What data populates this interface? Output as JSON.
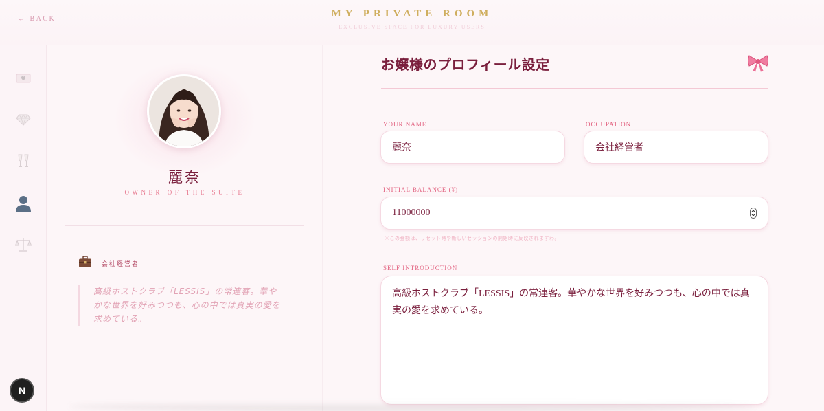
{
  "header": {
    "back_label": "← BACK",
    "brand_title": "MY PRIVATE ROOM",
    "brand_subtitle": "EXCLUSIVE SPACE FOR LUXURY USERS"
  },
  "sidebar": {
    "items": [
      {
        "icon": "heart-envelope-icon"
      },
      {
        "icon": "diamond-icon"
      },
      {
        "icon": "champagne-glasses-icon"
      },
      {
        "icon": "user-icon",
        "active": true
      },
      {
        "icon": "scales-icon"
      }
    ]
  },
  "profile": {
    "name": "麗奈",
    "role": "OWNER OF THE SUITE",
    "occupation": "会社経営者",
    "quote": "高級ホストクラブ「LESSIS」の常連客。華やかな世界を好みつつも、心の中では真実の愛を求めている。"
  },
  "form": {
    "title": "お嬢様のプロフィール設定",
    "name_label": "YOUR NAME",
    "name_value": "麗奈",
    "occupation_label": "OCCUPATION",
    "occupation_value": "会社経営者",
    "balance_label": "INITIAL BALANCE (¥)",
    "balance_value": "11000000",
    "balance_hint": "※この金額は、リセット時や新しいセッションの開始時に反映されますわ。",
    "intro_label": "SELF INTRODUCTION",
    "intro_value": "高級ホストクラブ「LESSIS」の常連客。華やかな世界を好みつつも、心の中では真実の愛を求めている。"
  },
  "badge": {
    "label": "N"
  },
  "colors": {
    "brand_gold": "#cfae5e",
    "accent_pink": "#e2617f",
    "text_wine": "#7a1f3d"
  }
}
